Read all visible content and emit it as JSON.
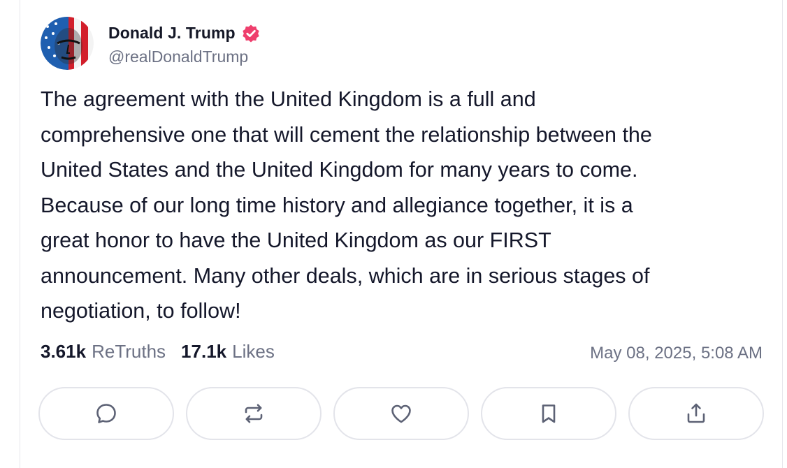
{
  "author": {
    "display_name": "Donald J. Trump",
    "handle": "@realDonaldTrump",
    "verified_icon": "verified-badge-icon",
    "verified_color": "#ef3f6d"
  },
  "post": {
    "text": "The agreement with the United Kingdom is a full and\ncomprehensive one that will cement the relationship between the\nUnited States and the United Kingdom for many years to come.\nBecause of our long time history and allegiance together, it is a\ngreat honor to have the United Kingdom as our FIRST\nannouncement. Many other deals, which are in serious stages of\nnegotiation, to follow!",
    "timestamp": "May 08, 2025, 5:08 AM"
  },
  "stats": {
    "retruths_count": "3.61k",
    "retruths_label": "ReTruths",
    "likes_count": "17.1k",
    "likes_label": "Likes"
  },
  "actions": [
    {
      "name": "reply",
      "icon": "chat-bubble-icon"
    },
    {
      "name": "retruth",
      "icon": "repost-icon"
    },
    {
      "name": "like",
      "icon": "heart-icon"
    },
    {
      "name": "bookmark",
      "icon": "bookmark-icon"
    },
    {
      "name": "share",
      "icon": "share-icon"
    }
  ],
  "colors": {
    "text": "#14172a",
    "muted": "#6c7184",
    "icon": "#5d6275",
    "button_border": "#e3e4ea"
  }
}
